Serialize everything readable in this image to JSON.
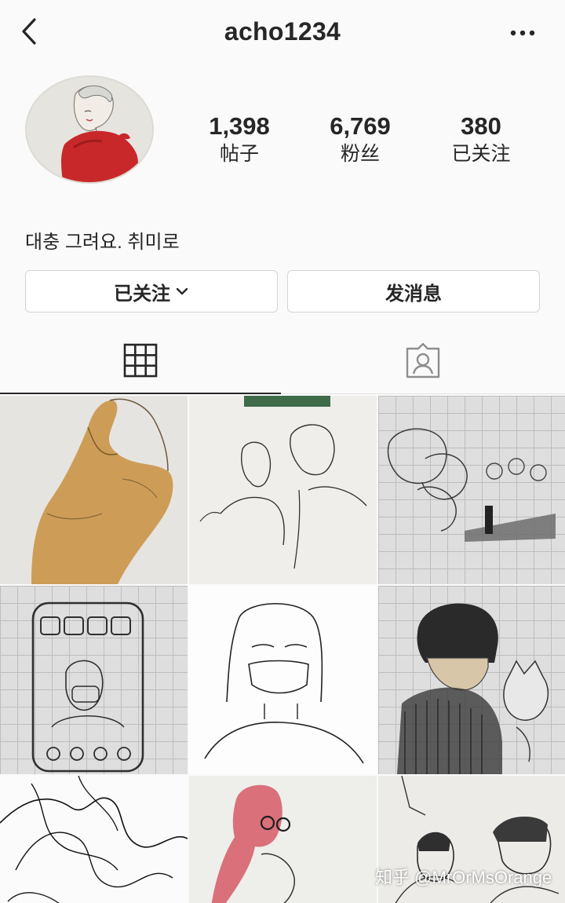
{
  "header": {
    "username": "acho1234",
    "back_icon": "chevron-left-icon",
    "more_icon": "more-horizontal-icon"
  },
  "profile": {
    "avatar": "illustrated-avatar",
    "stats": [
      {
        "value": "1,398",
        "label": "帖子"
      },
      {
        "value": "6,769",
        "label": "粉丝"
      },
      {
        "value": "380",
        "label": "已关注"
      }
    ],
    "bio": "대충 그려요. 취미로"
  },
  "actions": {
    "following_label": "已关注",
    "message_label": "发消息"
  },
  "tabs": [
    {
      "icon": "grid-icon",
      "selected": true
    },
    {
      "icon": "tagged-person-icon",
      "selected": false
    }
  ],
  "posts": [
    {
      "icon": "sketch-arms-orange"
    },
    {
      "icon": "sketch-couple-line"
    },
    {
      "icon": "sketch-faces-grid-paper"
    },
    {
      "icon": "sketch-phone-grid-paper"
    },
    {
      "icon": "sketch-woman-mask"
    },
    {
      "icon": "sketch-girl-bob-cat"
    },
    {
      "icon": "sketch-abstract-lines"
    },
    {
      "icon": "sketch-pink-figure"
    },
    {
      "icon": "sketch-two-portraits"
    }
  ],
  "watermark": "知乎 @MrOrMsOrange",
  "colors": {
    "background": "#fafafa",
    "text": "#262626",
    "border": "#d4d4d4",
    "accent_red": "#c8282a",
    "ochre": "#c8913e",
    "pink": "#d9707a"
  }
}
